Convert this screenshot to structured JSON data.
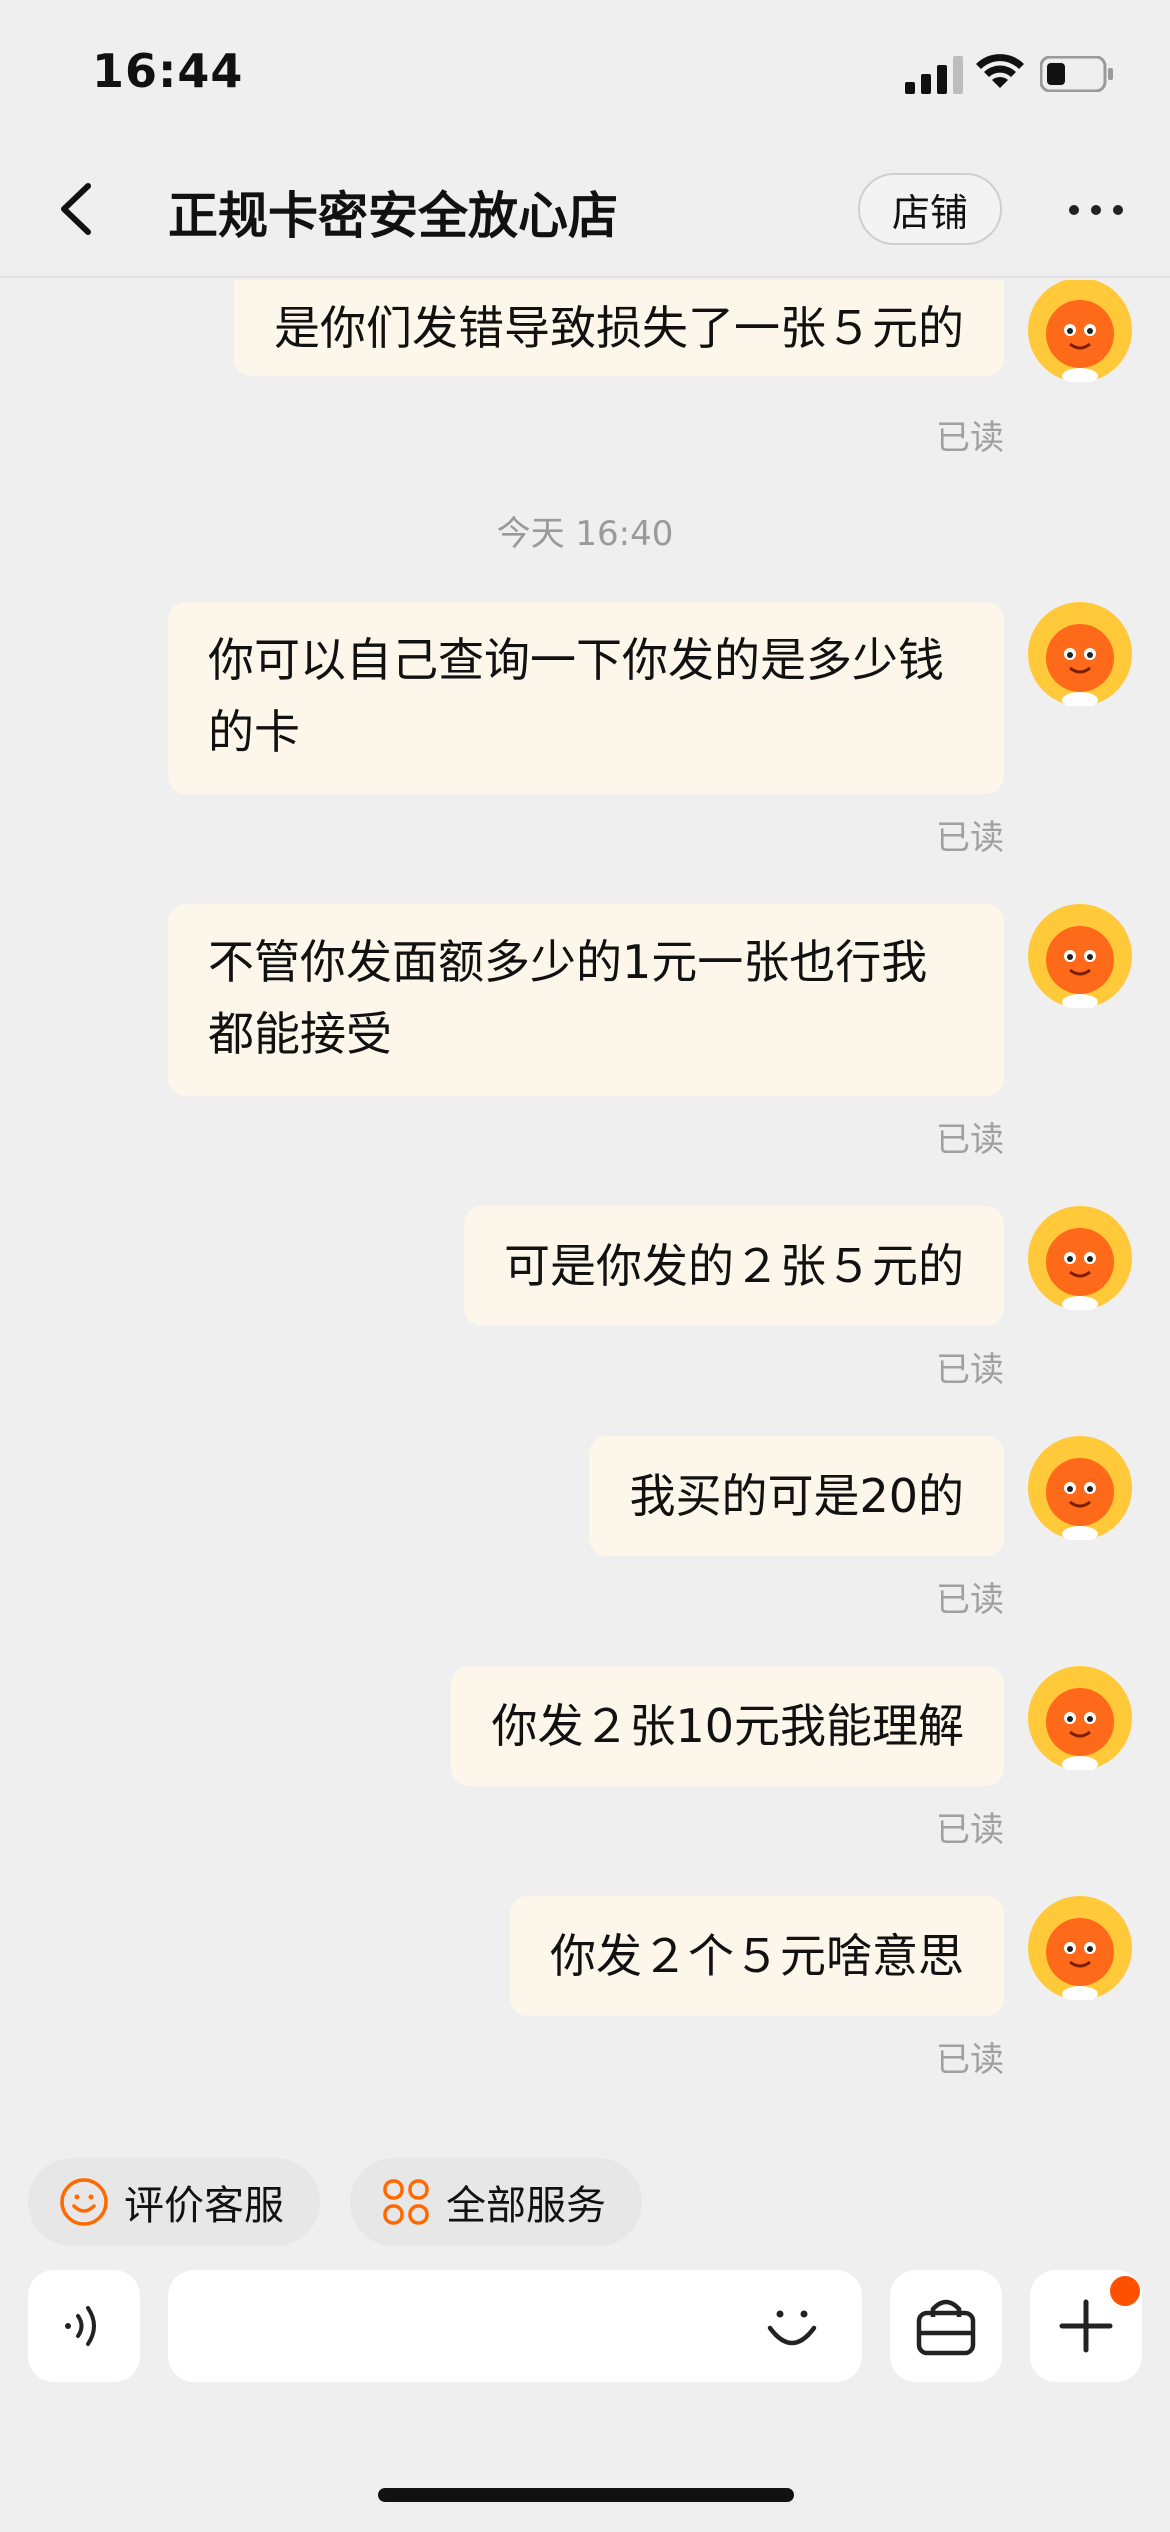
{
  "status_bar": {
    "time": "16:44"
  },
  "header": {
    "title": "正规卡密安全放心店",
    "shop_label": "店铺"
  },
  "chat": {
    "messages": [
      {
        "text": "是你们发错导致损失了一张５元的",
        "status": "已读"
      },
      {
        "text": "你可以自己查询一下你发的是多少钱的卡",
        "status": "已读"
      },
      {
        "text": "不管你发面额多少的1元一张也行我都能接受",
        "status": "已读"
      },
      {
        "text": "可是你发的２张５元的",
        "status": "已读"
      },
      {
        "text": "我买的可是20的",
        "status": "已读"
      },
      {
        "text": "你发２张10元我能理解",
        "status": "已读"
      },
      {
        "text": "你发２个５元啥意思",
        "status": "已读"
      }
    ],
    "time_separator": "今天 16:40"
  },
  "quick_actions": [
    {
      "label": "评价客服",
      "icon": "smile-icon"
    },
    {
      "label": "全部服务",
      "icon": "grid-icon"
    }
  ],
  "input": {
    "placeholder": ""
  },
  "colors": {
    "accent": "#ff5000",
    "bubble": "#fdf7eb",
    "icon_orange": "#ff6a00"
  }
}
